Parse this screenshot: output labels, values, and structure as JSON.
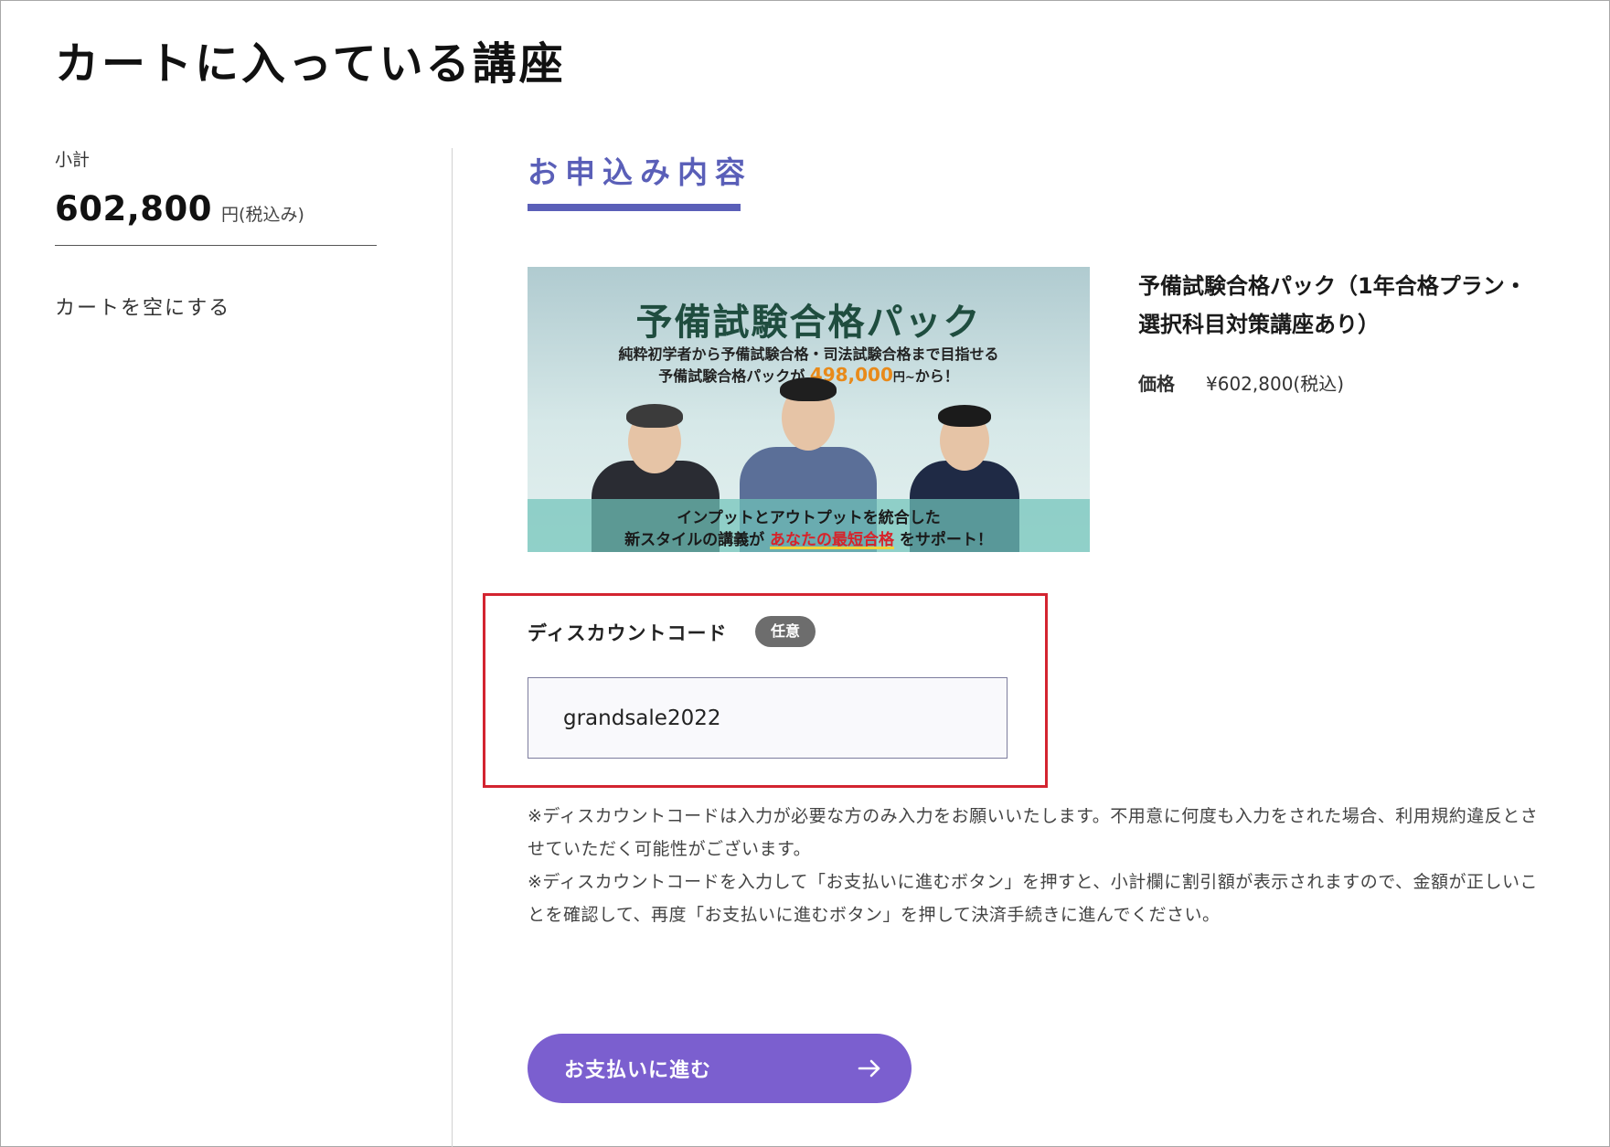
{
  "page": {
    "title": "カートに入っている講座"
  },
  "sidebar": {
    "subtotal_label": "小計",
    "subtotal_amount": "602,800",
    "subtotal_unit": "円(税込み)",
    "empty_cart_label": "カートを空にする"
  },
  "main": {
    "section_title": "お申込み内容",
    "banner": {
      "title": "予備試験合格パック",
      "subtitle_line1": "純粋初学者から予備試験合格・司法試験合格まで目指せる",
      "subtitle_line2_prefix": "予備試験合格パックが",
      "subtitle_price": "498,000",
      "subtitle_price_unit": "円~",
      "subtitle_line2_suffix": "から！",
      "strip_line1": "インプットとアウトプットを統合した",
      "strip_line2_prefix": "新スタイルの講義が",
      "strip_highlight": "あなたの最短合格",
      "strip_line2_suffix": "をサポート！"
    },
    "product": {
      "name": "予備試験合格パック（1年合格プラン・選択科目対策講座あり）",
      "price_label": "価格",
      "price_value": "¥602,800(税込)"
    },
    "discount": {
      "label": "ディスカウントコード",
      "optional_badge": "任意",
      "input_value": "grandsale2022"
    },
    "notes": {
      "note1": "※ディスカウントコードは入力が必要な方のみ入力をお願いいたします。不用意に何度も入力をされた場合、利用規約違反とさせていただく可能性がございます。",
      "note2": "※ディスカウントコードを入力して「お支払いに進むボタン」を押すと、小計欄に割引額が表示されますので、金額が正しいことを確認して、再度「お支払いに進むボタン」を押して決済手続きに進んでください。"
    },
    "proceed_button_label": "お支払いに進む"
  },
  "icons": {
    "proceed_icon": "arrow-right-icon"
  },
  "colors": {
    "accent": "#5a5fb8",
    "button": "#7b5fcf",
    "highlight_border": "#d32430",
    "badge": "#6d6d6d",
    "banner_price": "#e88a1a"
  }
}
